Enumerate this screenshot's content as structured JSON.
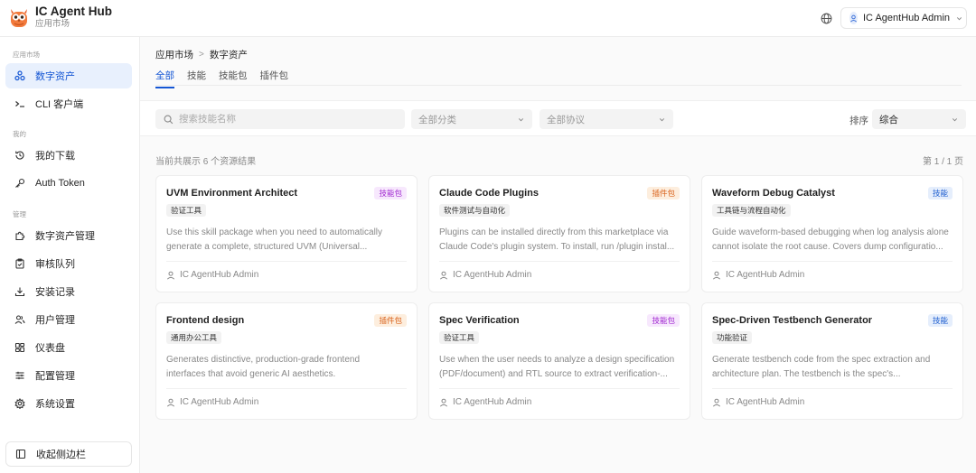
{
  "app": {
    "name": "IC Agent Hub",
    "subtitle": "应用市场"
  },
  "header": {
    "user_name": "IC AgentHub Admin",
    "icons": [
      "globe-icon",
      "user-icon",
      "chevron-down-icon"
    ]
  },
  "sidebar": {
    "sections": [
      {
        "label": "应用市场",
        "items": [
          {
            "label": "数字资产",
            "icon": "assets-icon",
            "active": true
          },
          {
            "label": "CLI 客户端",
            "icon": "terminal-icon",
            "active": false
          }
        ]
      },
      {
        "label": "我的",
        "items": [
          {
            "label": "我的下载",
            "icon": "history-icon",
            "active": false
          },
          {
            "label": "Auth Token",
            "icon": "key-icon",
            "active": false
          }
        ]
      },
      {
        "label": "管理",
        "items": [
          {
            "label": "数字资产管理",
            "icon": "puzzle-icon",
            "active": false
          },
          {
            "label": "审核队列",
            "icon": "clipboard-icon",
            "active": false
          },
          {
            "label": "安装记录",
            "icon": "download-icon",
            "active": false
          },
          {
            "label": "用户管理",
            "icon": "users-icon",
            "active": false
          },
          {
            "label": "仪表盘",
            "icon": "dashboard-icon",
            "active": false
          },
          {
            "label": "配置管理",
            "icon": "sliders-icon",
            "active": false
          },
          {
            "label": "系统设置",
            "icon": "gear-icon",
            "active": false
          }
        ]
      }
    ],
    "collapse_label": "收起侧边栏"
  },
  "breadcrumb": {
    "parent": "应用市场",
    "separator": ">",
    "current": "数字资产"
  },
  "tabs": [
    {
      "label": "全部",
      "active": true
    },
    {
      "label": "技能",
      "active": false
    },
    {
      "label": "技能包",
      "active": false
    },
    {
      "label": "插件包",
      "active": false
    }
  ],
  "filters": {
    "search_placeholder": "搜索技能名称",
    "category_value": "全部分类",
    "protocol_value": "全部协议",
    "sort_label": "排序",
    "sort_value": "综合"
  },
  "results": {
    "count_text": "当前共展示 6 个资源结果",
    "page_text": "第 1 / 1 页"
  },
  "colors": {
    "accent": "#1456d4",
    "badge_skillpack_bg": "#f7e8fd",
    "badge_skillpack_fg": "#a22bd1",
    "badge_plugin_bg": "#fdeede",
    "badge_plugin_fg": "#d9621b",
    "badge_skill_bg": "#e5eefc",
    "badge_skill_fg": "#1f5fd0"
  },
  "cards": [
    {
      "title": "UVM Environment Architect",
      "badge": "技能包",
      "badge_type": "skillpack",
      "tag": "验证工具",
      "desc_line1": "Use this skill package when you need to automatically",
      "desc_line2": "generate a complete, structured UVM (Universal...",
      "author": "IC AgentHub Admin"
    },
    {
      "title": "Claude Code Plugins",
      "badge": "插件包",
      "badge_type": "plugin",
      "tag": "软件测试与自动化",
      "desc_line1": "Plugins can be installed directly from this marketplace via",
      "desc_line2": "Claude Code's plugin system. To install, run /plugin instal...",
      "author": "IC AgentHub Admin"
    },
    {
      "title": "Waveform Debug Catalyst",
      "badge": "技能",
      "badge_type": "skill",
      "tag": "工具链与流程自动化",
      "desc_line1": "Guide waveform-based debugging when log analysis alone",
      "desc_line2": "cannot isolate the root cause. Covers dump configuratio...",
      "author": "IC AgentHub Admin"
    },
    {
      "title": "Frontend design",
      "badge": "插件包",
      "badge_type": "plugin",
      "tag": "通用办公工具",
      "desc_line1": "Generates distinctive, production-grade frontend",
      "desc_line2": "interfaces that avoid generic AI aesthetics.",
      "author": "IC AgentHub Admin"
    },
    {
      "title": "Spec Verification",
      "badge": "技能包",
      "badge_type": "skillpack",
      "tag": "验证工具",
      "desc_line1": "Use when the user needs to analyze a design specification",
      "desc_line2": "(PDF/document) and RTL source to extract verification-...",
      "author": "IC AgentHub Admin"
    },
    {
      "title": "Spec-Driven Testbench Generator",
      "badge": "技能",
      "badge_type": "skill",
      "tag": "功能验证",
      "desc_line1": "Generate testbench code from the spec extraction and",
      "desc_line2": "architecture plan. The testbench is the spec's...",
      "author": "IC AgentHub Admin"
    }
  ]
}
